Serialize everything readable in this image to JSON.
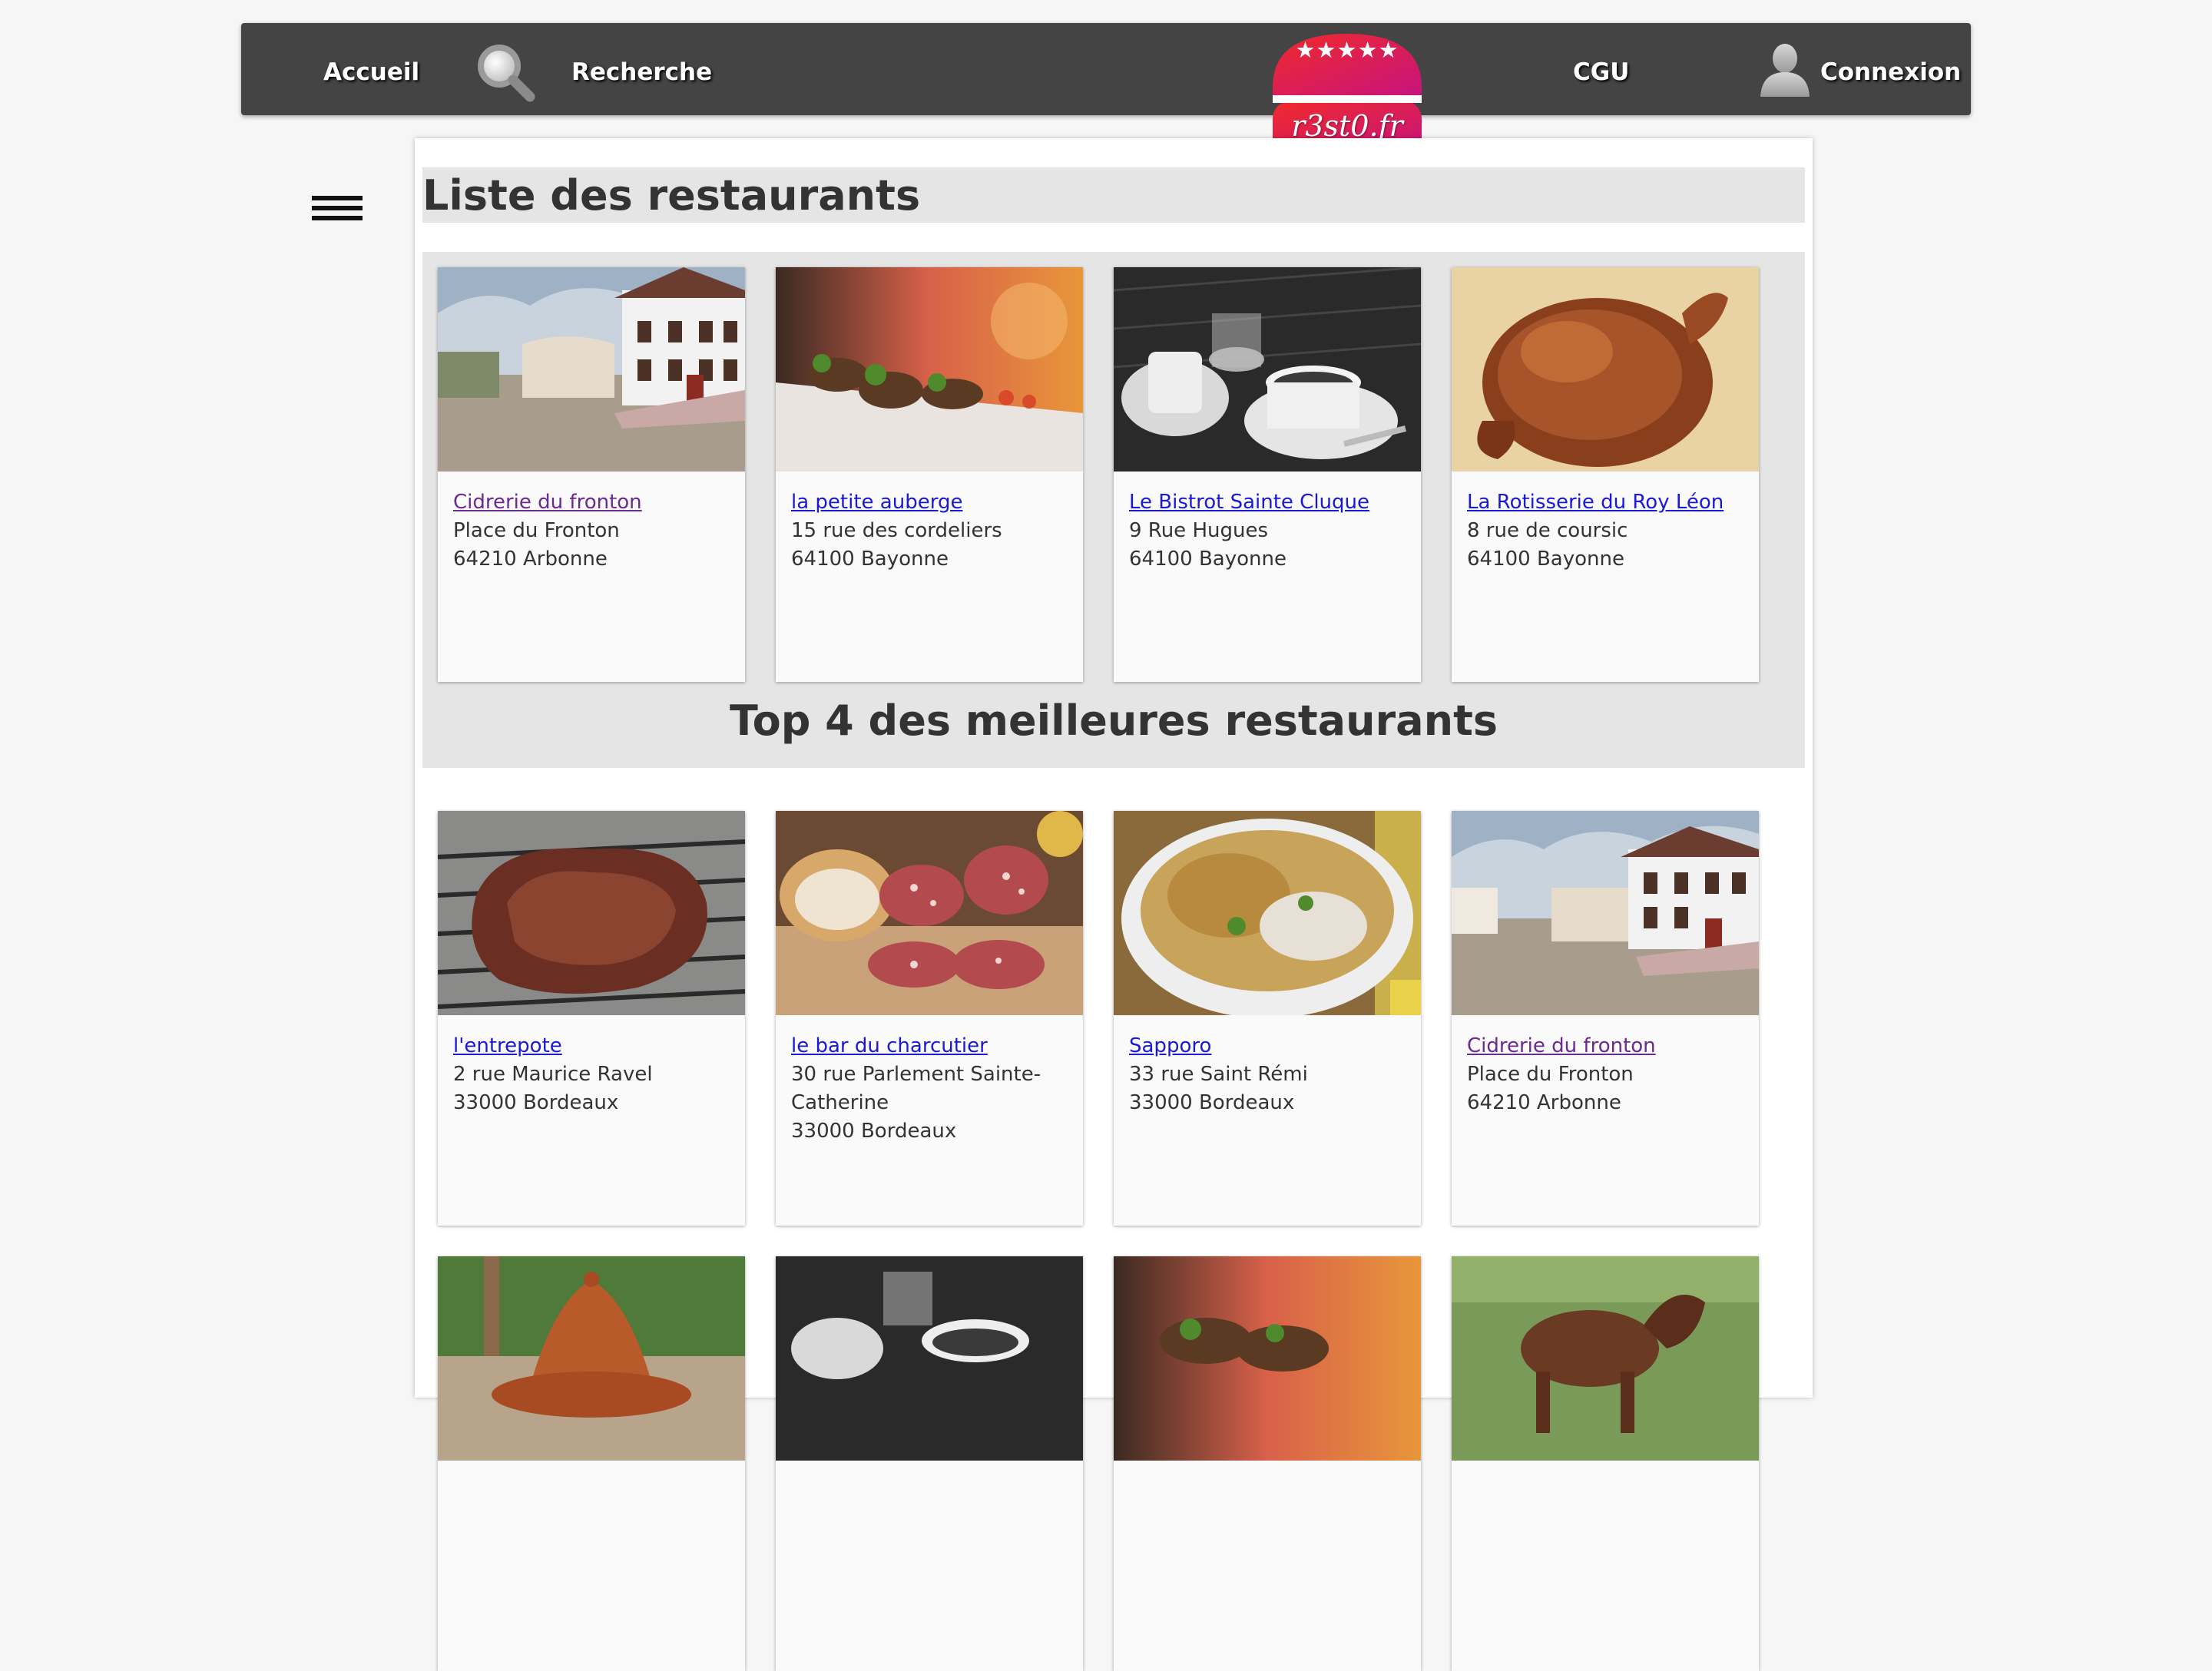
{
  "nav": {
    "home": "Accueil",
    "search": "Recherche",
    "terms": "CGU",
    "login": "Connexion",
    "logo_text": "r3st0.fr",
    "logo_stars": "★★★★★"
  },
  "list_section": {
    "title": "Liste des restaurants",
    "restaurants": [
      {
        "name": "Cidrerie du fronton",
        "address": "Place du Fronton",
        "city": "64210 Arbonne"
      },
      {
        "name": "la petite auberge",
        "address": "15 rue des cordeliers",
        "city": "64100 Bayonne"
      },
      {
        "name": "Le Bistrot Sainte Cluque",
        "address": "9 Rue Hugues",
        "city": "64100 Bayonne"
      },
      {
        "name": "La Rotisserie du Roy Léon",
        "address": "8 rue de coursic",
        "city": "64100 Bayonne"
      }
    ]
  },
  "top_section": {
    "title": "Top 4 des meilleures restaurants",
    "restaurants": [
      {
        "name": "l'entrepote",
        "address": "2 rue Maurice Ravel",
        "city": "33000 Bordeaux"
      },
      {
        "name": "le bar du charcutier",
        "address": "30 rue Parlement Sainte-Catherine",
        "city": "33000 Bordeaux"
      },
      {
        "name": "Sapporo",
        "address": "33 rue Saint Rémi",
        "city": "33000 Bordeaux"
      },
      {
        "name": "Cidrerie du fronton",
        "address": "Place du Fronton",
        "city": "64210 Arbonne"
      }
    ]
  },
  "colors": {
    "navbar": "#444444",
    "link": "#1a1ad6",
    "visited_link": "#6b2a8f",
    "logo_top": "#e8283c",
    "logo_bottom": "#c8187a"
  }
}
